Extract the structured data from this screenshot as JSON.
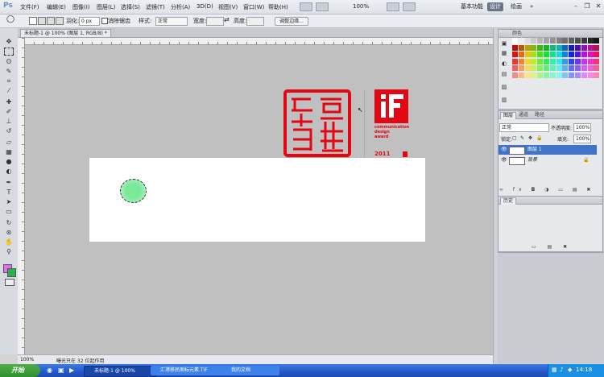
{
  "app": {
    "logo": "Ps"
  },
  "menu": {
    "items": [
      "文件(F)",
      "编辑(E)",
      "图像(I)",
      "图层(L)",
      "选择(S)",
      "滤镜(T)",
      "分析(A)",
      "3D(D)",
      "视图(V)",
      "窗口(W)",
      "帮助(H)"
    ],
    "zoom": "100%",
    "workspaces": [
      "基本功能",
      "设计",
      "绘画"
    ],
    "more": "»"
  },
  "options": {
    "feather_label": "羽化:",
    "feather_value": "0 px",
    "antialias_label": "消除锯齿",
    "style_label": "样式:",
    "style_value": "正常",
    "width_label": "宽度:",
    "height_label": "高度:",
    "refine_button": "调整边缘..."
  },
  "document": {
    "tab_label": "未标题-1 @ 100% (图层 1, RGB/8) *"
  },
  "canvas": {
    "if_award_lines": [
      "communication",
      "design",
      "award"
    ],
    "if_year": "2011",
    "if_logo": "iF"
  },
  "status": {
    "zoom": "100%",
    "text": "曝光只在 32 位起作用"
  },
  "panels": {
    "color_tabs": [
      "颜色",
      "色板",
      "样式"
    ],
    "layers_tabs": [
      "图层",
      "通道",
      "路径"
    ],
    "blend_mode": "正常",
    "opacity_label": "不透明度:",
    "opacity_value": "100%",
    "lock_label": "锁定:",
    "fill_label": "填充:",
    "fill_value": "100%",
    "layers": [
      {
        "name": "图层 1",
        "selected": true
      },
      {
        "name": "背景",
        "selected": false
      }
    ],
    "history_tab": "历史"
  },
  "taskbar": {
    "start": "开始",
    "tasks": [
      "未标题-1 @ 100%",
      "汇港移民图标元素.TIF",
      "我的文档"
    ],
    "clock": "14:18"
  },
  "colors": {
    "accent": "#e30613",
    "green": "#7be89a",
    "workspace_active": "#6a7688"
  }
}
